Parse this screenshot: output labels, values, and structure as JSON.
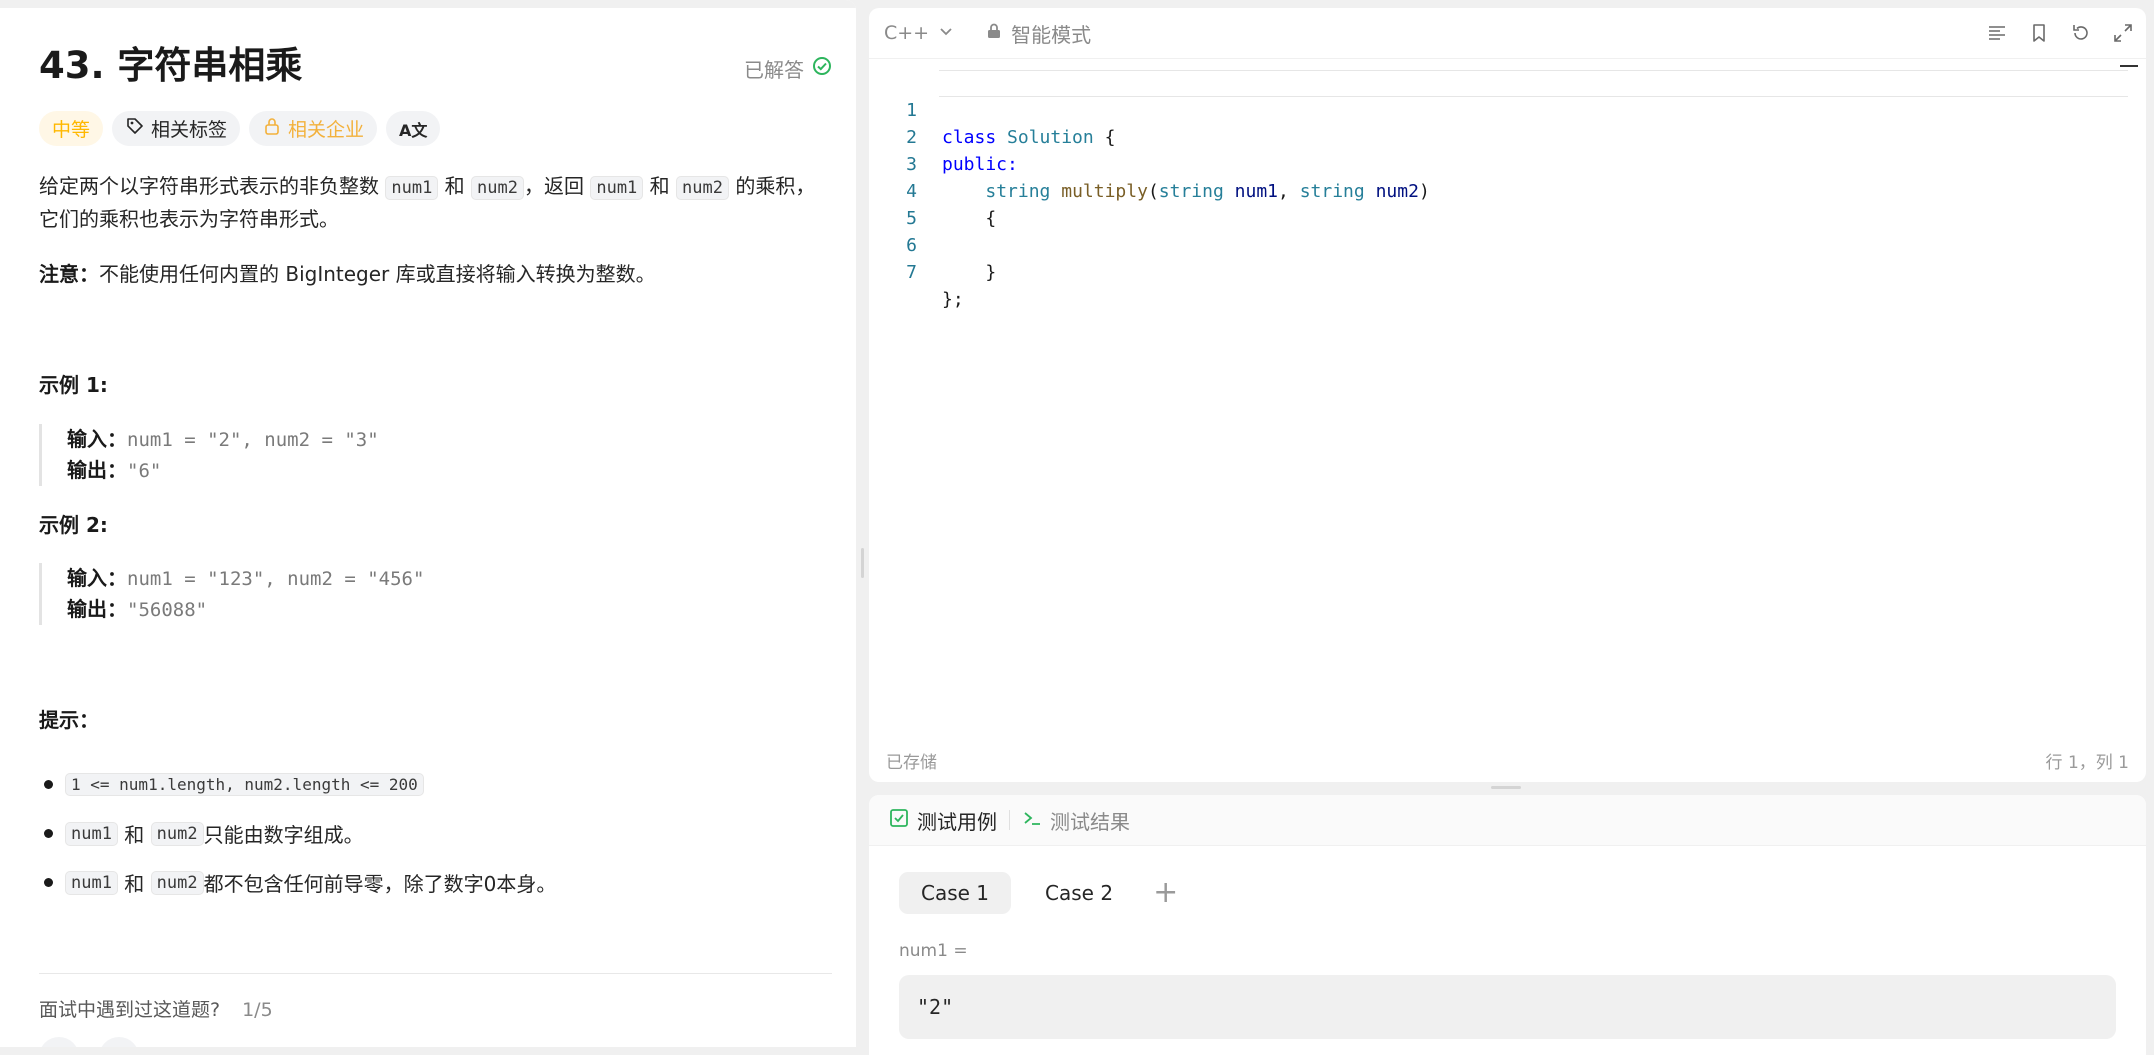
{
  "problem": {
    "title": "43. 字符串相乘",
    "solved_label": "已解答",
    "tags": {
      "difficulty": "中等",
      "related_tags": "相关标签",
      "related_companies": "相关企业",
      "translate": "A文"
    },
    "description": {
      "p1_a": "给定两个以字符串形式表示的非负整数 ",
      "p1_code1": "num1",
      "p1_b": " 和 ",
      "p1_code2": "num2",
      "p1_c": "，返回 ",
      "p1_code3": "num1",
      "p1_d": " 和 ",
      "p1_code4": "num2",
      "p1_e": " 的乘积，它们的乘积也表示为字符串形式。",
      "note_label": "注意：",
      "note_text": "不能使用任何内置的 BigInteger 库或直接将输入转换为整数。"
    },
    "examples": [
      {
        "heading": "示例 1:",
        "input_label": "输入：",
        "input_value": "num1 = \"2\", num2 = \"3\"",
        "output_label": "输出：",
        "output_value": "\"6\""
      },
      {
        "heading": "示例 2:",
        "input_label": "输入：",
        "input_value": "num1 = \"123\", num2 = \"456\"",
        "output_label": "输出：",
        "output_value": "\"56088\""
      }
    ],
    "hints_heading": "提示：",
    "hints": {
      "h1_code": "1 <= num1.length, num2.length <= 200",
      "h2_code1": "num1",
      "h2_mid": " 和 ",
      "h2_code2": "num2",
      "h2_text": " 只能由数字组成。",
      "h3_code1": "num1",
      "h3_mid": " 和 ",
      "h3_code2": "num2",
      "h3_text": " 都不包含任何前导零，除了数字0本身。"
    },
    "interview_question": "面试中遇到过这道题?",
    "interview_count": "1/5"
  },
  "editor": {
    "language": "C++",
    "mode": "智能模式",
    "line_numbers": [
      "1",
      "2",
      "3",
      "4",
      "5",
      "6",
      "7"
    ],
    "code": {
      "l1_kw": "class",
      "l1_ty": "Solution",
      "l1_rest": " {",
      "l2_kw": "public:",
      "l3_indent": "    ",
      "l3_ty1": "string",
      "l3_fn": "multiply",
      "l3_p1": "(",
      "l3_ty2": "string",
      "l3_v1": "num1",
      "l3_p2": ", ",
      "l3_ty3": "string",
      "l3_v2": "num2",
      "l3_p3": ")",
      "l4": "    {",
      "l5": "",
      "l6": "    }",
      "l7": "};"
    },
    "saved_status": "已存储",
    "cursor_position": "行 1，列 1"
  },
  "testpanel": {
    "tab_testcase": "测试用例",
    "tab_result": "测试结果",
    "cases": [
      "Case 1",
      "Case 2"
    ],
    "add_case": "+",
    "param_label": "num1 =",
    "param_value": "\"2\""
  },
  "colors": {
    "difficulty_medium": "#ffb800",
    "solved_green": "#2db55d",
    "keyword_blue": "#0000ff",
    "type_teal": "#267f99",
    "function_brown": "#795e26"
  }
}
